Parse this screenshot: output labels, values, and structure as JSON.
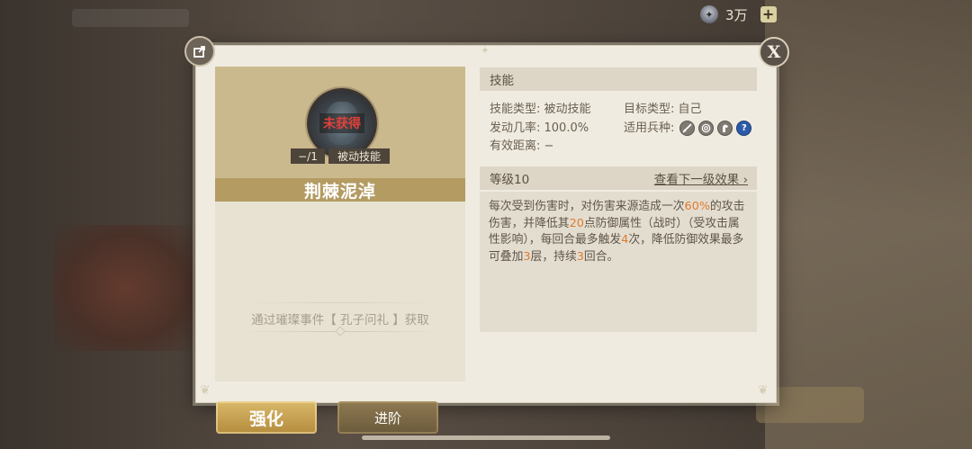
{
  "currency": {
    "icon": "coin-icon",
    "value": "3万",
    "add_label": "+"
  },
  "panel": {
    "share_icon": "share-icon",
    "close_label": "X"
  },
  "skill": {
    "status": "未获得",
    "level": "−/1",
    "type_badge": "被动技能",
    "name": "荆棘泥淖",
    "source": "通过璀璨事件【 孔子问礼 】获取"
  },
  "info": {
    "section_title": "技能",
    "rows": [
      {
        "left": "技能类型: 被动技能",
        "right": "目标类型: 自己"
      },
      {
        "left": "发动几率: 100.0%",
        "right": "适用兵种:"
      },
      {
        "left": "有效距离: −",
        "right": ""
      }
    ],
    "unit_icons": [
      "sword-icon",
      "bow-target-icon",
      "horse-icon",
      "question-icon"
    ]
  },
  "level": {
    "title": "等级10",
    "next_link": "查看下一级效果 ›",
    "desc_parts": [
      {
        "t": "每次受到伤害时，对伤害来源造成一次",
        "hl": false
      },
      {
        "t": "60%",
        "hl": true
      },
      {
        "t": "的攻击伤害，并降低其",
        "hl": false
      },
      {
        "t": "20",
        "hl": true
      },
      {
        "t": "点防御属性（战时）（受攻击属性影响），每回合最多触发",
        "hl": false
      },
      {
        "t": "4",
        "hl": true
      },
      {
        "t": "次，降低防御效果最多可叠加",
        "hl": false
      },
      {
        "t": "3",
        "hl": true
      },
      {
        "t": "层，持续",
        "hl": false
      },
      {
        "t": "3",
        "hl": true
      },
      {
        "t": "回合。",
        "hl": false
      }
    ]
  },
  "bottom": {
    "strengthen_label": "强化",
    "advance_label": "进阶"
  },
  "colors": {
    "highlight": "#e07a2a",
    "not_obtained": "#e2403a",
    "name_bar": "#b39b62"
  }
}
